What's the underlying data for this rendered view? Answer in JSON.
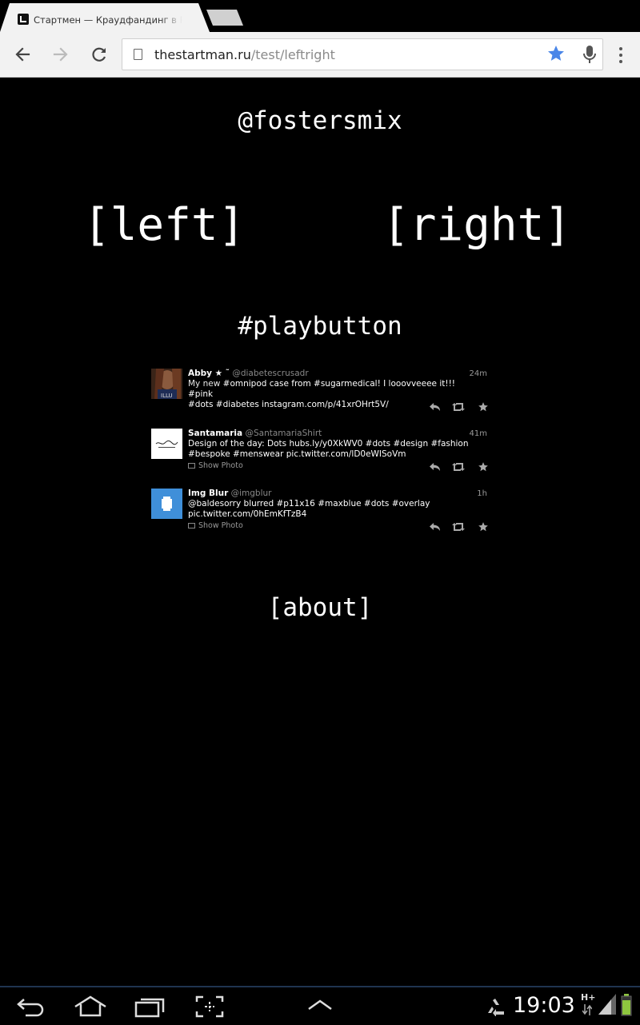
{
  "browser": {
    "tab_title": "Стартмен — Краудфандинг в России",
    "url_host": "thestartman.ru",
    "url_path": "/test/leftright",
    "accent": "#4a86e8"
  },
  "page": {
    "handle": "@fostersmix",
    "nav_left": "[left]",
    "nav_right": "[right]",
    "playbutton": "#playbutton",
    "about": "[about]"
  },
  "tweets": [
    {
      "name": "Abby ★ ˜",
      "username": "@diabetescrusadr",
      "time": "24m",
      "text_pre": "My new ",
      "text_line1": "#omnipod case from #sugarmedical! I looovveeee it!!! #pink",
      "text_line2": " #dots #diabetes instagram.com/p/41xrOHrt5V/",
      "show_photo": ""
    },
    {
      "name": "Santamaria",
      "username": "@SantamariaShirt",
      "time": "41m",
      "text_line1": "Design of the day: Dots hubs.ly/y0XkWV0 #dots #design #fashion",
      "text_line2": " #bespoke #menswear pic.twitter.com/lD0eWISoVm",
      "show_photo": "Show Photo"
    },
    {
      "name": "Img Blur",
      "username": "@imgblur",
      "time": "1h",
      "text_line1": "@baldesorry blurred #p11x16 #maxblue #dots #overlay",
      "text_line2": " pic.twitter.com/0hEmKfTzB4",
      "show_photo": "Show Photo"
    }
  ],
  "status_bar": {
    "time": "19:03",
    "network": "H+"
  }
}
